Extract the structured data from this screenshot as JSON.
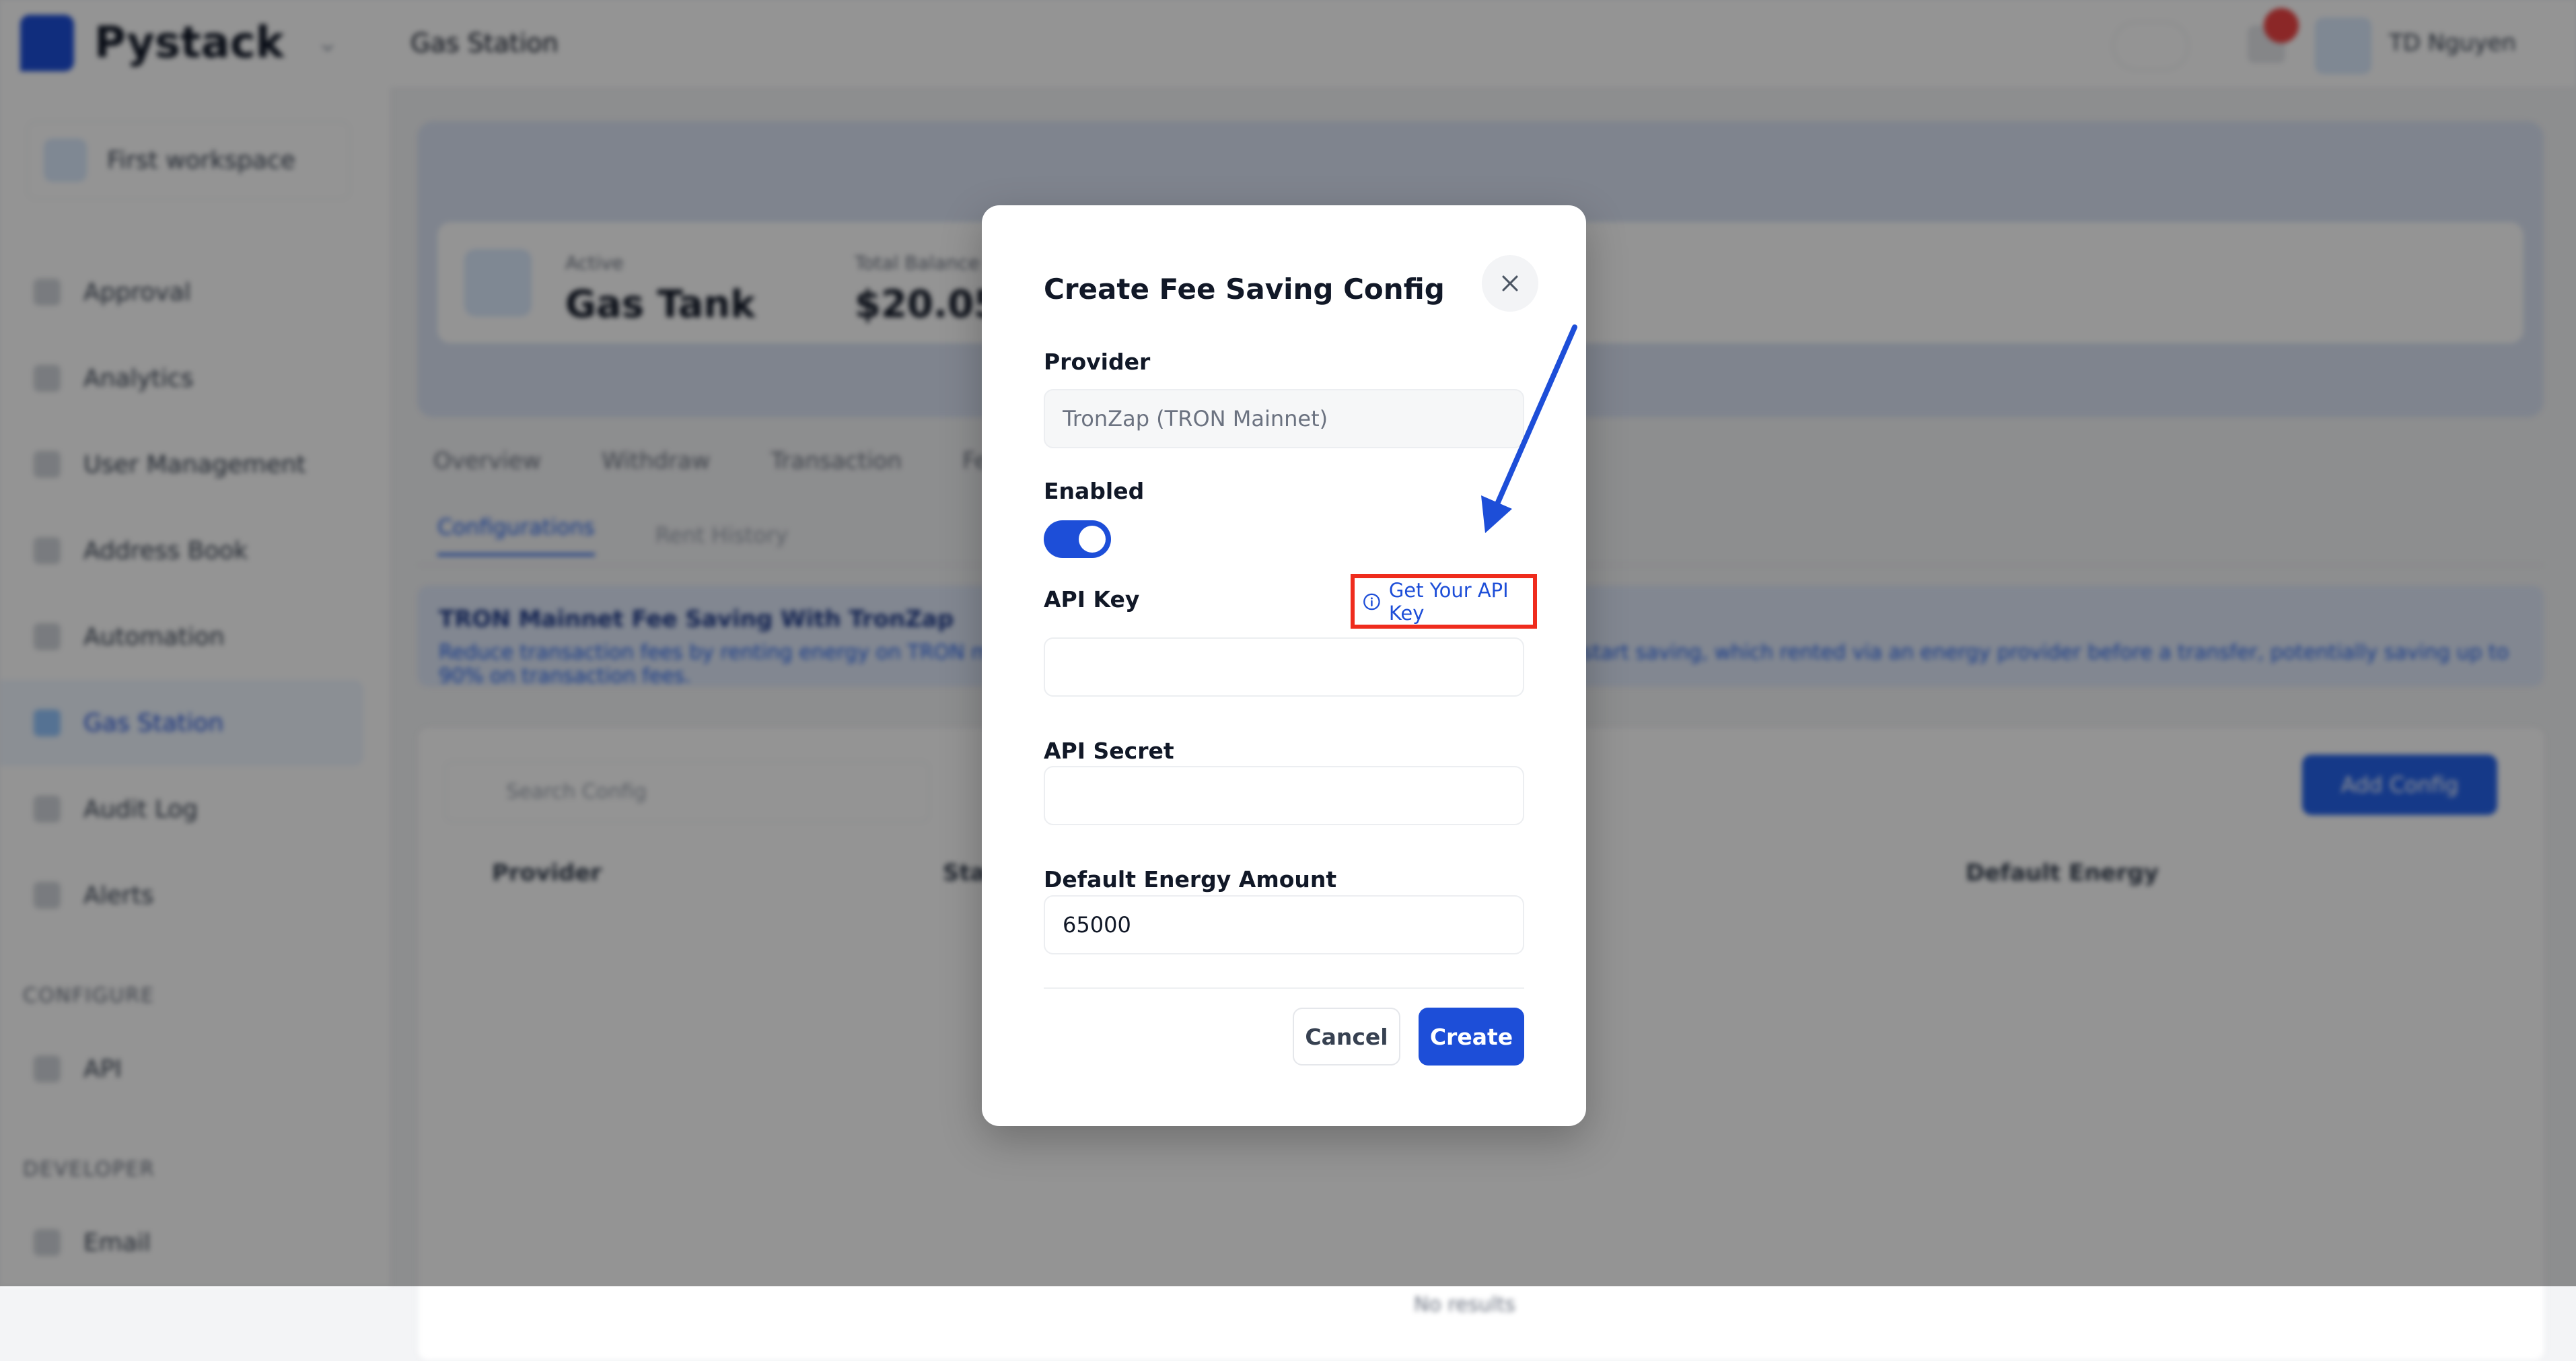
{
  "background": {
    "brand": "Pystack",
    "workspace": "First workspace",
    "nav_items": [
      "Approval",
      "Analytics",
      "User Management",
      "Address Book",
      "Automation",
      "Gas Station",
      "Audit Log",
      "Alerts"
    ],
    "active_nav_index": 5,
    "section_config": "CONFIGURE",
    "nav_config_items": [
      "API"
    ],
    "section_developer": "DEVELOPER",
    "nav_developer_items": [
      "Email"
    ],
    "page_title": "Gas Station",
    "user": "TD Nguyen",
    "hero": {
      "label1": "Active",
      "value1": "Gas Tank",
      "label2": "Total Balance",
      "value2": "$20.05"
    },
    "tabs": [
      "Overview",
      "Withdraw",
      "Transaction",
      "Fee Saving"
    ],
    "subtabs": [
      "Configurations",
      "Rent History"
    ],
    "banner_title": "TRON Mainnet Fee Saving With TronZap",
    "banner_text": "Reduce transaction fees by renting energy on TRON mainnet instead of burning TRX. Enable a provider below to start saving, which rented via an energy provider before a transfer, potentially saving up to 90% on transaction fees.",
    "search_placeholder": "Search Config",
    "add_button": "Add Config",
    "table_headers": [
      "Provider",
      "Status",
      "Default Energy"
    ],
    "empty_text": "No results"
  },
  "modal": {
    "title": "Create Fee Saving Config",
    "provider_label": "Provider",
    "provider_value": "TronZap (TRON Mainnet)",
    "enabled_label": "Enabled",
    "enabled": true,
    "api_key_label": "API Key",
    "api_key_value": "",
    "get_api_key_link": "Get Your API Key",
    "api_secret_label": "API Secret",
    "api_secret_value": "",
    "energy_label": "Default Energy Amount",
    "energy_value": "65000",
    "cancel": "Cancel",
    "create": "Create"
  },
  "colors": {
    "primary": "#1d4ed8",
    "highlight_box": "#ef2c1d",
    "annotation_arrow": "#1d4ed8"
  }
}
